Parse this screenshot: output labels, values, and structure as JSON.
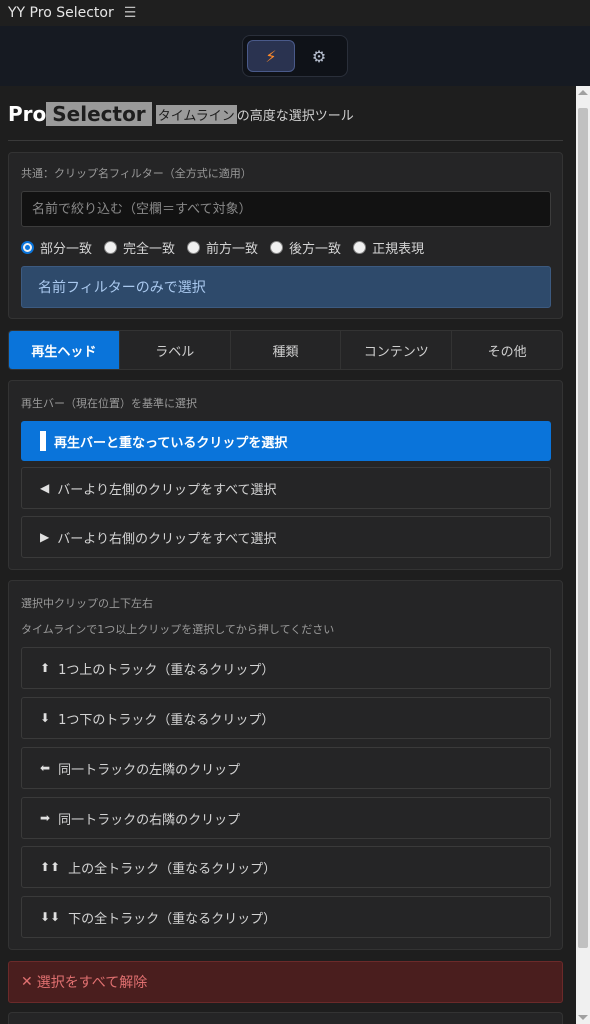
{
  "app": {
    "title": "YY Pro Selector"
  },
  "toolbar": {
    "modes": [
      "bolt-icon",
      "gear-icon"
    ],
    "active_mode": "bolt"
  },
  "header": {
    "brand_pro": "Pro",
    "brand_selector": "Selector",
    "tagline_highlight": "タイムライン",
    "tagline_rest": "の高度な選択ツール"
  },
  "filter": {
    "label": "共通：クリップ名フィルター（全方式に適用）",
    "placeholder": "名前で絞り込む（空欄＝すべて対象）",
    "options": [
      "部分一致",
      "完全一致",
      "前方一致",
      "後方一致",
      "正規表現"
    ],
    "selected": "部分一致",
    "button": "名前フィルターのみで選択"
  },
  "tabs": [
    "再生ヘッド",
    "ラベル",
    "種類",
    "コンテンツ",
    "その他"
  ],
  "active_tab": "再生ヘッド",
  "playhead": {
    "label": "再生バー（現在位置）を基準に選択",
    "buttons": [
      {
        "icon": "▌",
        "label": "再生バーと重なっているクリップを選択"
      },
      {
        "icon": "◀",
        "label": "バーより左側のクリップをすべて選択"
      },
      {
        "icon": "▶",
        "label": "バーより右側のクリップをすべて選択"
      }
    ]
  },
  "move": {
    "label": "選択中クリップの上下左右",
    "hint": "タイムラインで1つ以上クリップを選択してから押してください",
    "buttons": [
      {
        "icon": "⬆",
        "label": "1つ上のトラック（重なるクリップ）"
      },
      {
        "icon": "⬇",
        "label": "1つ下のトラック（重なるクリップ）"
      },
      {
        "icon": "⬅",
        "label": "同一トラックの左隣のクリップ"
      },
      {
        "icon": "➡",
        "label": "同一トラックの右隣のクリップ"
      },
      {
        "icon": "⬆⬆",
        "label": "上の全トラック（重なるクリップ）"
      },
      {
        "icon": "⬇⬇",
        "label": "下の全トラック（重なるクリップ）"
      }
    ]
  },
  "clear": {
    "icon": "✕",
    "label": "選択をすべて解除"
  },
  "colors": {
    "accent": "#0a74da",
    "danger_bg": "#4a1e1e",
    "danger_text": "#e07070"
  }
}
